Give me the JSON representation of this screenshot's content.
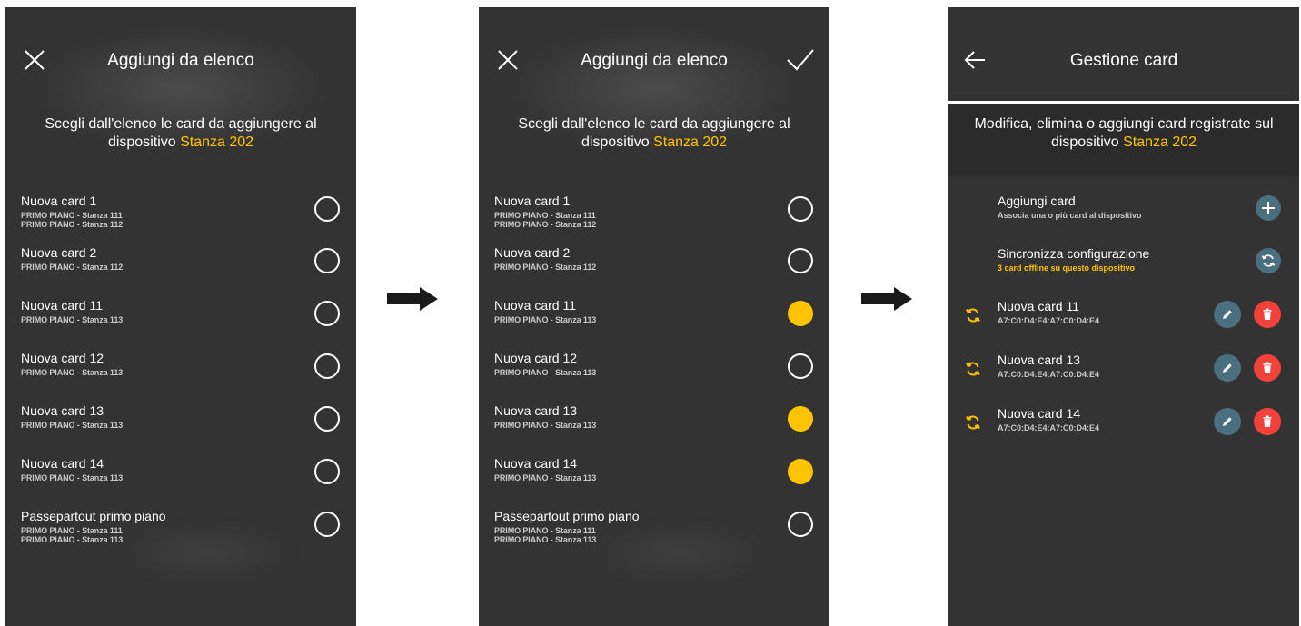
{
  "screens": [
    {
      "title": "Aggiungi da elenco",
      "subtitle_text": "Scegli dall'elenco le card da aggiungere al dispositivo",
      "device": "Stanza 202",
      "items": [
        {
          "name": "Nuova card 1",
          "sub1": "PRIMO PIANO - Stanza 111",
          "sub2": "PRIMO PIANO - Stanza 112",
          "selected": false
        },
        {
          "name": "Nuova card 2",
          "sub1": "PRIMO PIANO - Stanza 112",
          "sub2": "",
          "selected": false
        },
        {
          "name": "Nuova card 11",
          "sub1": "PRIMO PIANO - Stanza 113",
          "sub2": "",
          "selected": false
        },
        {
          "name": "Nuova card 12",
          "sub1": "PRIMO PIANO - Stanza 113",
          "sub2": "",
          "selected": false
        },
        {
          "name": "Nuova card 13",
          "sub1": "PRIMO PIANO - Stanza 113",
          "sub2": "",
          "selected": false
        },
        {
          "name": "Nuova card 14",
          "sub1": "PRIMO PIANO - Stanza 113",
          "sub2": "",
          "selected": false
        },
        {
          "name": "Passepartout primo piano",
          "sub1": "PRIMO PIANO - Stanza 111",
          "sub2": "PRIMO PIANO - Stanza 113",
          "selected": false
        }
      ]
    },
    {
      "title": "Aggiungi da elenco",
      "subtitle_text": "Scegli dall'elenco le card da aggiungere al dispositivo",
      "device": "Stanza 202",
      "items": [
        {
          "name": "Nuova card 1",
          "sub1": "PRIMO PIANO - Stanza 111",
          "sub2": "PRIMO PIANO - Stanza 112",
          "selected": false
        },
        {
          "name": "Nuova card 2",
          "sub1": "PRIMO PIANO - Stanza 112",
          "sub2": "",
          "selected": false
        },
        {
          "name": "Nuova card 11",
          "sub1": "PRIMO PIANO - Stanza 113",
          "sub2": "",
          "selected": true
        },
        {
          "name": "Nuova card 12",
          "sub1": "PRIMO PIANO - Stanza 113",
          "sub2": "",
          "selected": false
        },
        {
          "name": "Nuova card 13",
          "sub1": "PRIMO PIANO - Stanza 113",
          "sub2": "",
          "selected": true
        },
        {
          "name": "Nuova card 14",
          "sub1": "PRIMO PIANO - Stanza 113",
          "sub2": "",
          "selected": true
        },
        {
          "name": "Passepartout primo piano",
          "sub1": "PRIMO PIANO - Stanza 111",
          "sub2": "PRIMO PIANO - Stanza 113",
          "selected": false
        }
      ]
    },
    {
      "title": "Gestione card",
      "subtitle_text": "Modifica, elimina o aggiungi card registrate sul dispositivo",
      "device": "Stanza 202",
      "actions": [
        {
          "name": "Aggiungi card",
          "sub": "Associa una o più card al dispositivo",
          "icon": "plus-icon"
        },
        {
          "name": "Sincronizza configurazione",
          "sub": "3 card offline su questo dispositivo",
          "icon": "sync-icon"
        }
      ],
      "cards": [
        {
          "name": "Nuova card 11",
          "mac": "A7:C0:D4:E4:A7:C0:D4:E4"
        },
        {
          "name": "Nuova card 13",
          "mac": "A7:C0:D4:E4:A7:C0:D4:E4"
        },
        {
          "name": "Nuova card 14",
          "mac": "A7:C0:D4:E4:A7:C0:D4:E4"
        }
      ]
    }
  ],
  "colors": {
    "background": "#333333",
    "accent": "#ffc300",
    "edit_button": "#4a7080",
    "delete_button": "#f2413a"
  }
}
